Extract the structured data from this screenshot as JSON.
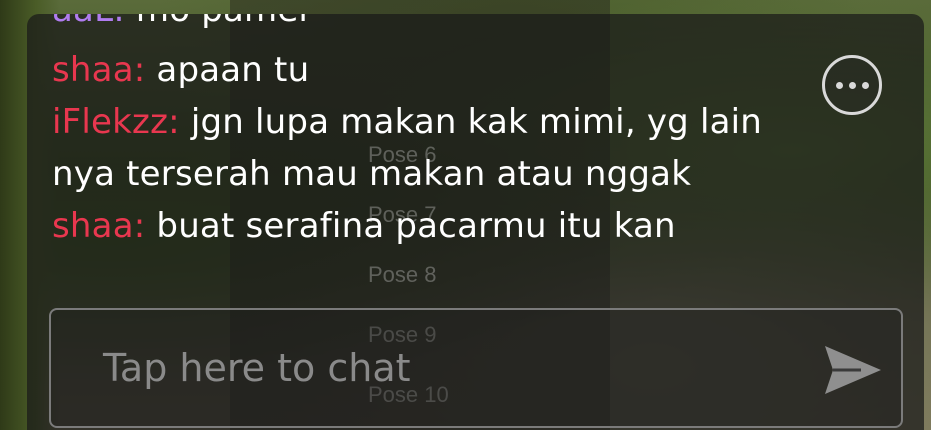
{
  "chat": {
    "messages": [
      {
        "sender": "aaL:",
        "text": "mo pamer",
        "sender_color": "#b07cf0"
      },
      {
        "sender": "shaa:",
        "text": "apaan tu",
        "sender_color": "#e8374f"
      },
      {
        "sender": "iFlekzz:",
        "text": "jgn lupa makan kak mimi, yg lain",
        "sender_color": "#e8374f"
      },
      {
        "sender": "",
        "text": "nya terserah mau makan atau nggak",
        "sender_color": "#e8374f"
      },
      {
        "sender": "shaa:",
        "text": "buat serafina pacarmu itu kan",
        "sender_color": "#e8374f"
      }
    ],
    "input_placeholder": "Tap here to chat"
  },
  "pose_menu": {
    "items": [
      "Pose 6",
      "Pose 7",
      "Pose 8",
      "Pose 9",
      "Pose 10"
    ]
  },
  "icons": {
    "more": "more-options-icon",
    "send": "send-icon"
  }
}
